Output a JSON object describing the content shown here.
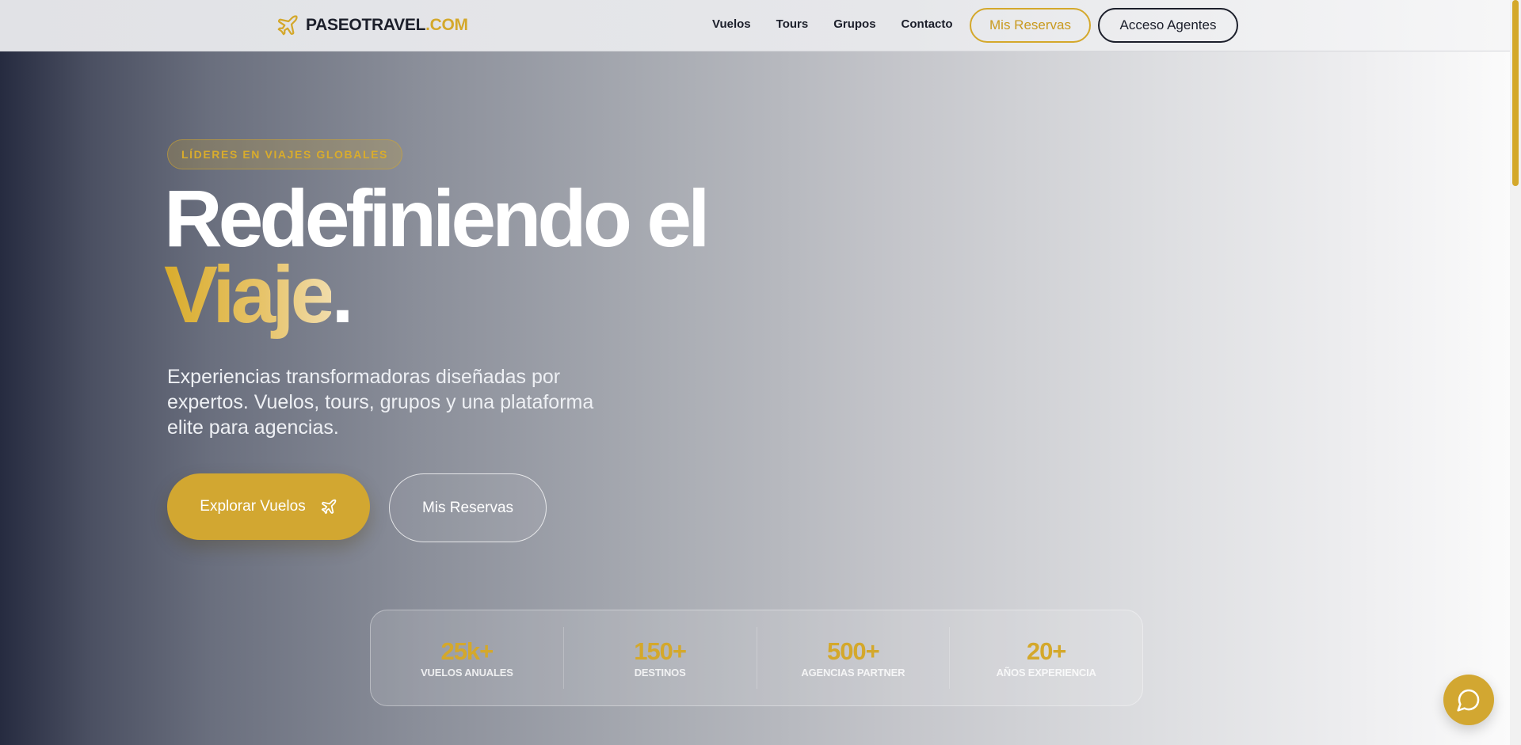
{
  "brand": {
    "name": "PASEOTRAVEL",
    "tld": ".COM",
    "icon": "plane-icon"
  },
  "nav": {
    "links": [
      "Vuelos",
      "Tours",
      "Grupos",
      "Contacto"
    ],
    "reservations_label": "Mis Reservas",
    "agents_label": "Acceso Agentes"
  },
  "hero": {
    "badge": "LÍDERES EN VIAJES GLOBALES",
    "headline_line1": "Redefiniendo el",
    "headline_accent": "Viaje",
    "headline_period": ".",
    "subtitle": "Experiencias transformadoras diseñadas por expertos. Vuelos, tours, grupos y una plataforma elite para agencias.",
    "primary_cta": "Explorar Vuelos",
    "secondary_cta": "Mis Reservas"
  },
  "stats": [
    {
      "value": "25k+",
      "label": "VUELOS ANUALES"
    },
    {
      "value": "150+",
      "label": "DESTINOS"
    },
    {
      "value": "500+",
      "label": "AGENCIAS PARTNER"
    },
    {
      "value": "20+",
      "label": "AÑOS EXPERIENCIA"
    }
  ],
  "chat": {
    "icon": "chat-bubble-icon"
  },
  "colors": {
    "accent": "#d4a82b",
    "dark": "#1c1f2b",
    "white": "#ffffff"
  }
}
